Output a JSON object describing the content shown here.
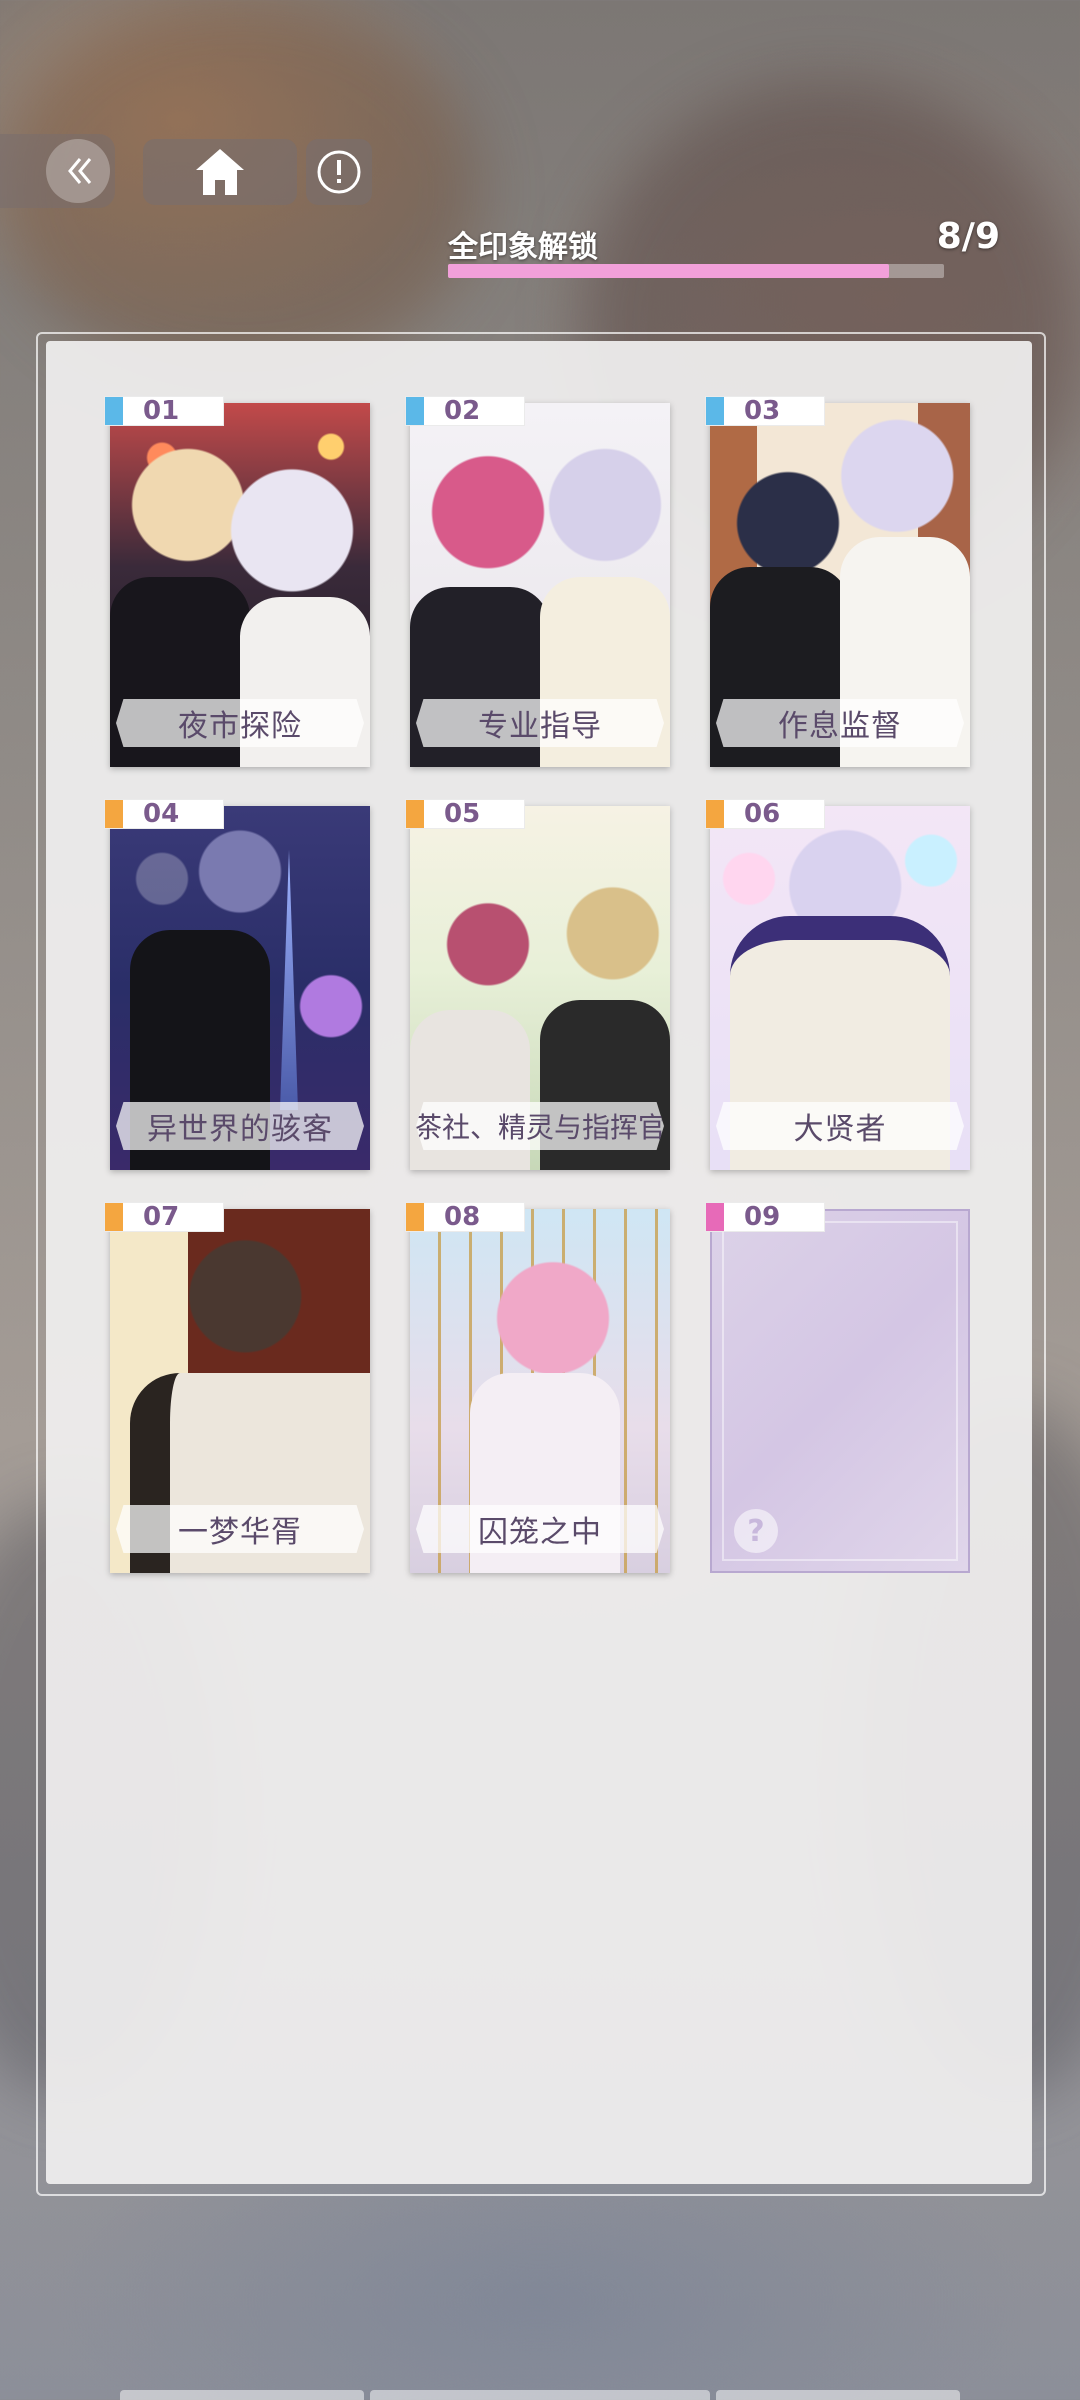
{
  "progress": {
    "label": "全印象解锁",
    "count": "8/9",
    "fraction": 0.889
  },
  "colors": {
    "tag_blue": "#5bb8e8",
    "tag_orange": "#f4a640",
    "tag_pink": "#e76ab8",
    "progress_fill": "#f2a0da",
    "card_title": "#5a4a6a"
  },
  "icons": {
    "back": "double-chevron-left-icon",
    "home": "home-icon",
    "info": "exclamation-circle-icon",
    "locked": "question-mark-icon"
  },
  "cards": [
    {
      "num": "01",
      "title": "夜市探险",
      "tag_color": "blue",
      "unlocked": true
    },
    {
      "num": "02",
      "title": "专业指导",
      "tag_color": "blue",
      "unlocked": true
    },
    {
      "num": "03",
      "title": "作息监督",
      "tag_color": "blue",
      "unlocked": true
    },
    {
      "num": "04",
      "title": "异世界的骇客",
      "tag_color": "orange",
      "unlocked": true
    },
    {
      "num": "05",
      "title": "茶社、精灵与指挥官",
      "tag_color": "orange",
      "unlocked": true
    },
    {
      "num": "06",
      "title": "大贤者",
      "tag_color": "orange",
      "unlocked": true
    },
    {
      "num": "07",
      "title": "一梦华胥",
      "tag_color": "orange",
      "unlocked": true
    },
    {
      "num": "08",
      "title": "囚笼之中",
      "tag_color": "orange",
      "unlocked": true
    },
    {
      "num": "09",
      "title": "",
      "tag_color": "pink",
      "unlocked": false,
      "locked_symbol": "?"
    }
  ]
}
